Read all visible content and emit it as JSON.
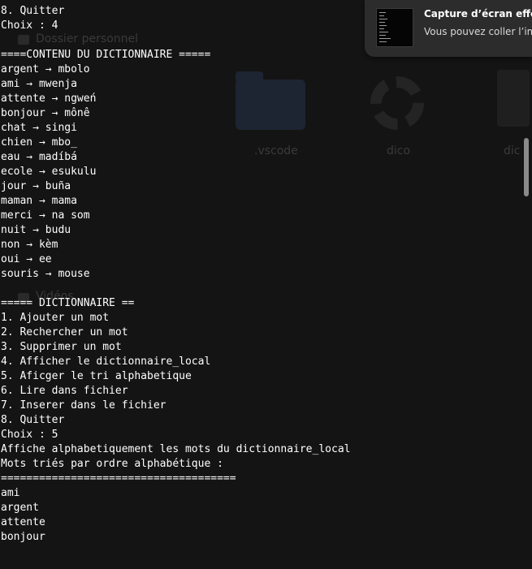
{
  "background": {
    "sidebar_labels": [
      "Dossier personnel",
      "Vidéos"
    ],
    "folder_labels": [
      ".vscode",
      "dico",
      "dic"
    ]
  },
  "terminal": {
    "lines": [
      "8. Quitter",
      "Choix : 4",
      "",
      "====CONTENU DU DICTIONNAIRE =====",
      "argent → mbolo",
      "ami → mwenja",
      "attente → ngweń",
      "bonjour → mônê",
      "chat → singi",
      "chien → mbo_",
      "eau → madíbá",
      "ecole → esukulu",
      "jour → buña",
      "maman → mama",
      "merci → na som",
      "nuit → budu",
      "non → kèm",
      "oui → ee",
      "souris → mouse",
      "",
      "===== DICTIONNAIRE ==",
      "1. Ajouter un mot",
      "2. Rechercher un mot",
      "3. Supprimer un mot",
      "4. Afficher le dictionnaire_local",
      "5. Aficger le tri alphabetique",
      "6. Lire dans fichier",
      "7. Inserer dans le fichier",
      "8. Quitter",
      "Choix : 5",
      "Affiche alphabetiquement les mots du dictionnaire_local",
      "Mots triés par ordre alphabétique :",
      "=====================================",
      "ami",
      "argent",
      "attente",
      "bonjour"
    ]
  },
  "notification": {
    "title": "Capture d’écran effect",
    "body": "Vous pouvez coller l’im"
  }
}
